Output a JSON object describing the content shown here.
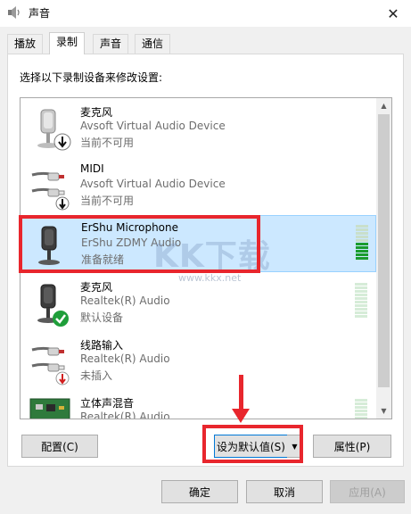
{
  "window": {
    "title": "声音"
  },
  "tabs": [
    {
      "label": "播放",
      "active": false
    },
    {
      "label": "录制",
      "active": true
    },
    {
      "label": "声音",
      "active": false
    },
    {
      "label": "通信",
      "active": false
    }
  ],
  "instructions": "选择以下录制设备来修改设置:",
  "devices": [
    {
      "name": "麦克风",
      "description": "Avsoft Virtual Audio Device",
      "status": "当前不可用",
      "icon": "microphone-icon",
      "badge": "down-arrow-badge",
      "selected": false,
      "level": 0
    },
    {
      "name": "MIDI",
      "description": "Avsoft Virtual Audio Device",
      "status": "当前不可用",
      "icon": "line-in-cable-icon",
      "badge": "down-arrow-badge",
      "selected": false,
      "level": 0
    },
    {
      "name": "ErShu Microphone",
      "description": "ErShu ZDMY Audio",
      "status": "准备就绪",
      "icon": "microphone-icon",
      "badge": "",
      "selected": true,
      "level": 0.5
    },
    {
      "name": "麦克风",
      "description": "Realtek(R) Audio",
      "status": "默认设备",
      "icon": "microphone-icon",
      "badge": "green-check-badge",
      "selected": false,
      "level": 0
    },
    {
      "name": "线路输入",
      "description": "Realtek(R) Audio",
      "status": "未插入",
      "icon": "line-in-cable-icon",
      "badge": "red-down-arrow-badge",
      "selected": false,
      "level": 0
    },
    {
      "name": "立体声混音",
      "description": "Realtek(R) Audio",
      "status": "",
      "icon": "circuit-board-icon",
      "badge": "",
      "selected": false,
      "level": 0
    }
  ],
  "buttons": {
    "configure": "配置(C)",
    "set_default": "设为默认值(S)",
    "properties": "属性(P)",
    "ok": "确定",
    "cancel": "取消",
    "apply": "应用(A)"
  },
  "watermark": {
    "text": "KK下载",
    "url": "www.kkx.net"
  },
  "colors": {
    "selection": "#cce8ff",
    "highlight": "#e8262d",
    "level_on": "#1a9c2e"
  }
}
